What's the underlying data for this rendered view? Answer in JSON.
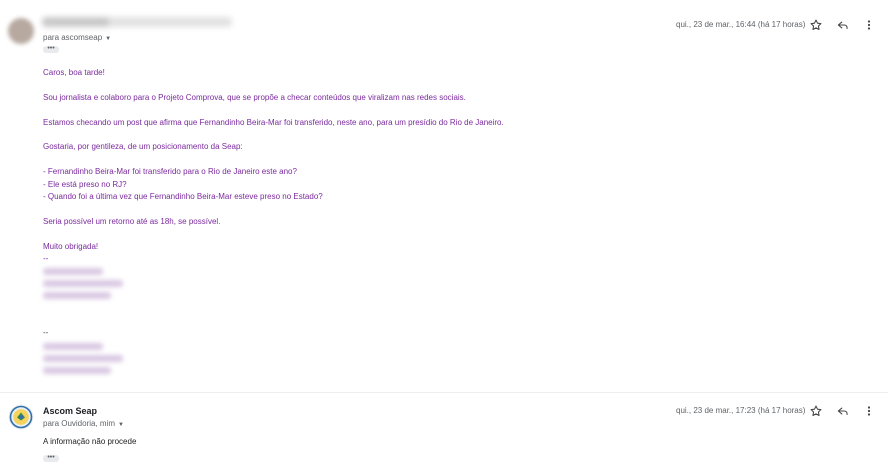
{
  "message1": {
    "to_line": "para ascomseap",
    "date": "qui., 23 de mar., 16:44 (há 17 horas)",
    "more_label": "•••",
    "body": {
      "greeting": "Caros, boa tarde!",
      "p1": "Sou jornalista e colaboro para o Projeto Comprova, que se propõe a checar conteúdos que viralizam nas redes sociais.",
      "p2": "Estamos checando um post que afirma que Fernandinho Beira-Mar foi transferido, neste ano, para um presídio do Rio de Janeiro.",
      "p3": "Gostaria, por gentileza, de um posicionamento da Seap:",
      "q1": "- Fernandinho Beira-Mar foi transferido para o Rio de Janeiro este ano?",
      "q2": "- Ele está preso no RJ?",
      "q3": "- Quando foi a última vez que Fernandinho Beira-Mar esteve preso no Estado?",
      "p4": "Seria possível um retorno até as 18h, se possível.",
      "closing": "Muito obrigada!",
      "sig_sep1": "--",
      "sig_sep2": "--"
    }
  },
  "message2": {
    "sender": "Ascom Seap",
    "to_line": "para Ouvidoria, mim",
    "date": "qui., 23 de mar., 17:23 (há 17 horas)",
    "body": "A informação não procede",
    "more_label": "•••"
  },
  "icons": [
    "star-icon",
    "reply-icon",
    "more-vert-icon"
  ]
}
